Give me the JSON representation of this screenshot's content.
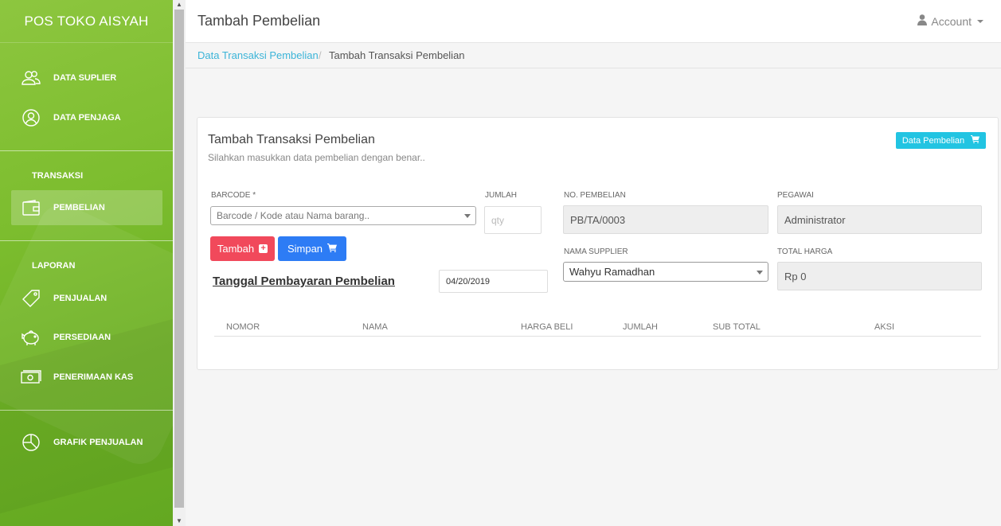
{
  "sidebar": {
    "brand": "POS TOKO AISYAH",
    "items": [
      {
        "label": "DATA SUPLIER",
        "icon": "users-icon"
      },
      {
        "label": "DATA PENJAGA",
        "icon": "user-circle-icon"
      },
      {
        "label": "PEMBELIAN",
        "icon": "wallet-icon",
        "active": true
      },
      {
        "label": "PENJUALAN",
        "icon": "tag-icon"
      },
      {
        "label": "PERSEDIAAN",
        "icon": "piggy-bank-icon"
      },
      {
        "label": "PENERIMAAN KAS",
        "icon": "cash-icon"
      },
      {
        "label": "GRAFIK PENJUALAN",
        "icon": "pie-chart-icon"
      }
    ],
    "sections": {
      "transaksi": "TRANSAKSI",
      "laporan": "LAPORAN"
    }
  },
  "header": {
    "title": "Tambah Pembelian",
    "account": "Account"
  },
  "breadcrumb": {
    "link": "Data Transaksi Pembelian",
    "separator": "/",
    "current": "Tambah Transaksi Pembelian"
  },
  "panel": {
    "title": "Tambah Transaksi Pembelian",
    "subtitle": "Silahkan masukkan data pembelian dengan benar..",
    "data_pembelian_button": "Data Pembelian"
  },
  "form": {
    "barcode_label": "BARCODE *",
    "barcode_placeholder": "Barcode / Kode atau Nama barang..",
    "jumlah_label": "JUMLAH",
    "jumlah_placeholder": "qty",
    "no_pembelian_label": "NO. PEMBELIAN",
    "no_pembelian_value": "PB/TA/0003",
    "pegawai_label": "PEGAWAI",
    "pegawai_value": "Administrator",
    "tambah_button": "Tambah",
    "simpan_button": "Simpan",
    "nama_supplier_label": "NAMA SUPPLIER",
    "nama_supplier_value": "Wahyu Ramadhan",
    "total_harga_label": "TOTAL HARGA",
    "total_harga_value": "Rp 0",
    "tanggal_heading": "Tanggal Pembayaran Pembelian",
    "tanggal_value": "04/20/2019"
  },
  "table": {
    "columns": [
      "NOMOR",
      "NAMA",
      "HARGA BELI",
      "JUMLAH",
      "SUB TOTAL",
      "AKSI"
    ]
  },
  "colors": {
    "sidebar": "#7cbd2e",
    "primary": "#2d7cf5",
    "danger": "#f1495b",
    "info": "#22c4e2",
    "link": "#3bb4d8"
  }
}
